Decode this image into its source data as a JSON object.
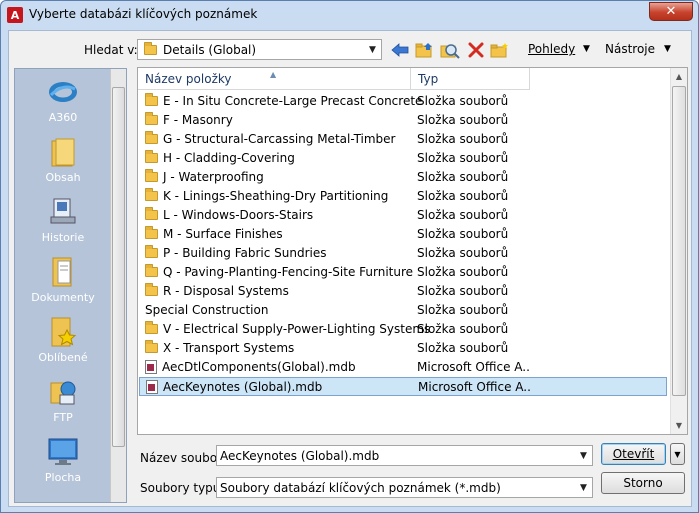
{
  "window": {
    "title": "Vyberte databázi klíčových poznámek",
    "close_glyph": "✕"
  },
  "toolbar": {
    "look_in_label": "Hledat v:",
    "look_in_value": "Details (Global)",
    "views_label": "Pohledy",
    "tools_label": "Nástroje"
  },
  "places": [
    {
      "label": "A360",
      "icon": "a360-icon"
    },
    {
      "label": "Obsah",
      "icon": "folder-icon"
    },
    {
      "label": "Historie",
      "icon": "history-icon"
    },
    {
      "label": "Dokumenty",
      "icon": "documents-icon"
    },
    {
      "label": "Oblíbené",
      "icon": "favorites-icon"
    },
    {
      "label": "FTP",
      "icon": "ftp-icon"
    },
    {
      "label": "Plocha",
      "icon": "desktop-icon"
    }
  ],
  "file_list": {
    "columns": [
      "Název položky",
      "Typ"
    ],
    "rows": [
      {
        "name": "E - In Situ Concrete-Large Precast Concrete",
        "type": "Složka souborů",
        "icon": "folder-icon"
      },
      {
        "name": "F - Masonry",
        "type": "Složka souborů",
        "icon": "folder-icon"
      },
      {
        "name": "G - Structural-Carcassing Metal-Timber",
        "type": "Složka souborů",
        "icon": "folder-icon"
      },
      {
        "name": "H - Cladding-Covering",
        "type": "Složka souborů",
        "icon": "folder-icon"
      },
      {
        "name": "J - Waterproofing",
        "type": "Složka souborů",
        "icon": "folder-icon"
      },
      {
        "name": "K - Linings-Sheathing-Dry Partitioning",
        "type": "Složka souborů",
        "icon": "folder-icon"
      },
      {
        "name": "L - Windows-Doors-Stairs",
        "type": "Složka souborů",
        "icon": "folder-icon"
      },
      {
        "name": "M - Surface Finishes",
        "type": "Složka souborů",
        "icon": "folder-icon"
      },
      {
        "name": "P - Building Fabric Sundries",
        "type": "Složka souborů",
        "icon": "folder-icon"
      },
      {
        "name": "Q - Paving-Planting-Fencing-Site Furniture",
        "type": "Složka souborů",
        "icon": "folder-icon"
      },
      {
        "name": "R - Disposal Systems",
        "type": "Složka souborů",
        "icon": "folder-icon"
      },
      {
        "name": "Special Construction",
        "type": "Složka souborů",
        "icon": "none"
      },
      {
        "name": "V - Electrical Supply-Power-Lighting Systems",
        "type": "Složka souborů",
        "icon": "folder-icon"
      },
      {
        "name": "X - Transport Systems",
        "type": "Složka souborů",
        "icon": "folder-icon"
      },
      {
        "name": "AecDtlComponents(Global).mdb",
        "type": "Microsoft Office A...",
        "icon": "mdb-icon"
      },
      {
        "name": "AecKeynotes (Global).mdb",
        "type": "Microsoft Office A...",
        "icon": "mdb-icon",
        "selected": true
      }
    ]
  },
  "form": {
    "filename_label": "Název souboru:",
    "filename_value": "AecKeynotes (Global).mdb",
    "filetype_label": "Soubory typu:",
    "filetype_value": "Soubory databází klíčových poznámek (*.mdb)",
    "open_label": "Otevřít",
    "cancel_label": "Storno"
  },
  "colors": {
    "accent": "#c4161c",
    "selection": "#cde6f7",
    "places_bg": "#b5c4d8"
  }
}
